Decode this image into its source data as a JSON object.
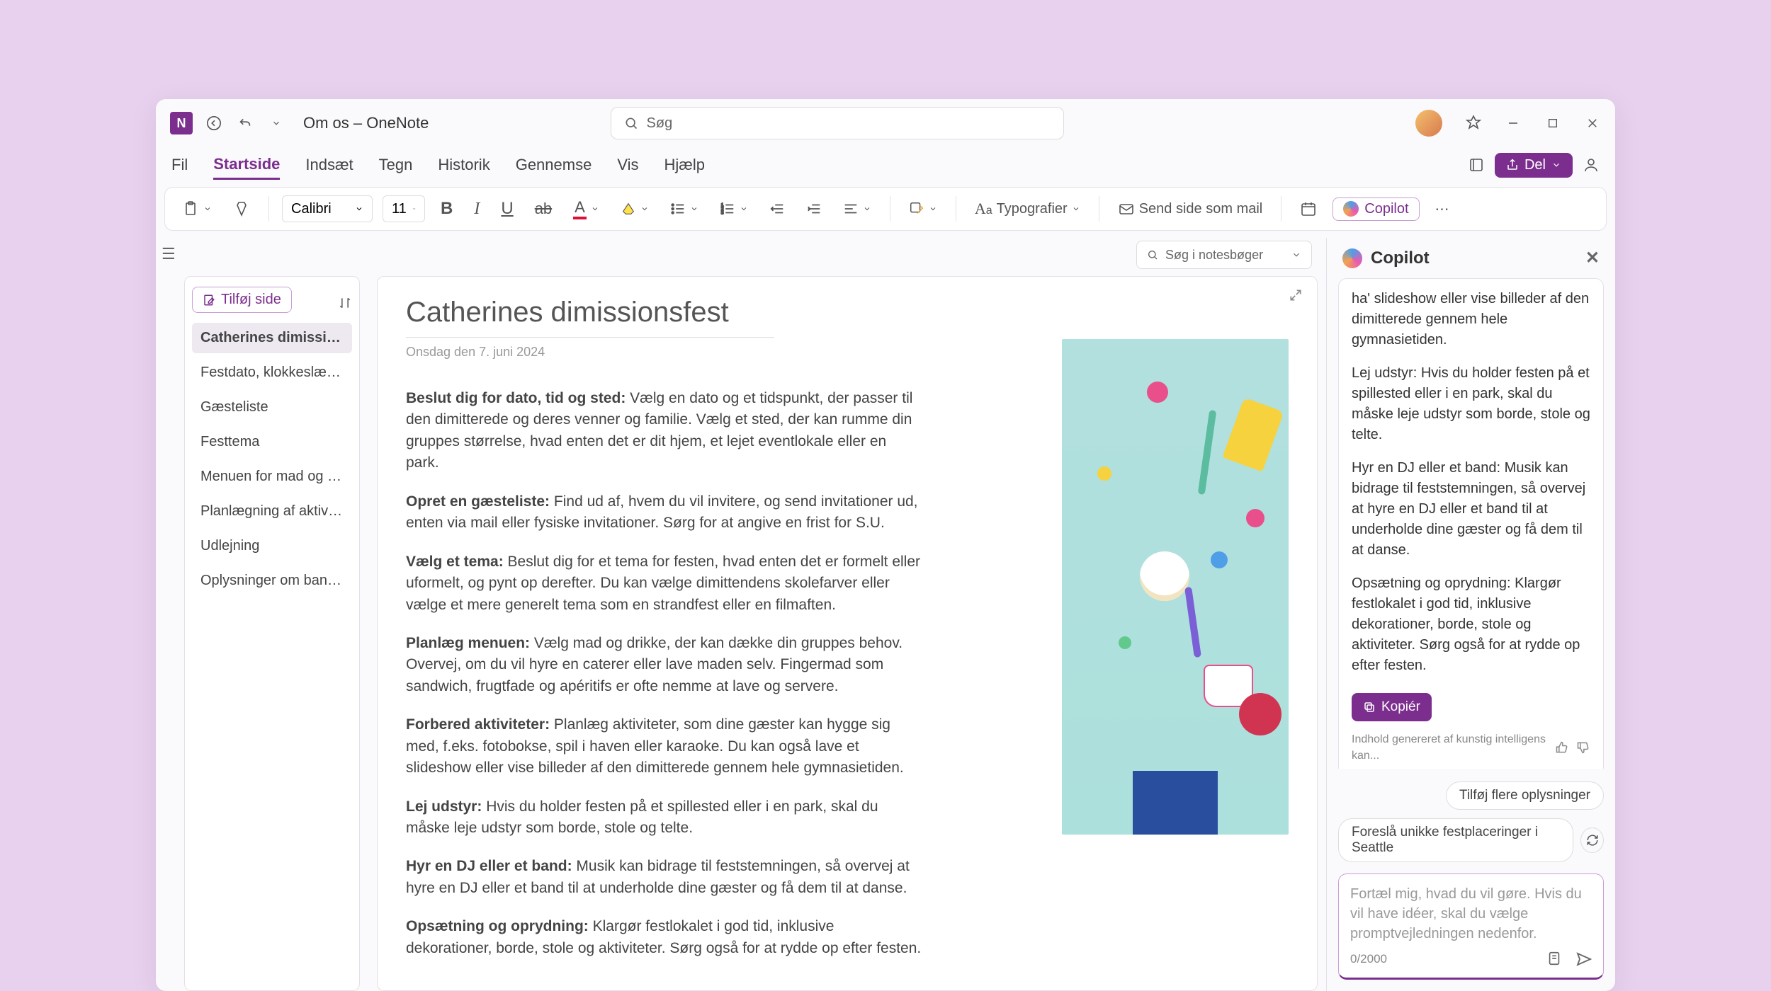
{
  "titlebar": {
    "app_title": "Om os – OneNote",
    "search_placeholder": "Søg"
  },
  "menubar": {
    "tabs": [
      "Fil",
      "Startside",
      "Indsæt",
      "Tegn",
      "Historik",
      "Gennemse",
      "Vis",
      "Hjælp"
    ],
    "active_index": 1,
    "share_label": "Del"
  },
  "ribbon": {
    "font_name": "Calibri",
    "font_size": "11",
    "styles_label": "Typografier",
    "send_label": "Send side som mail",
    "copilot_label": "Copilot"
  },
  "notebook_search_placeholder": "Søg i notesbøger",
  "sidebar": {
    "add_page_label": "Tilføj side",
    "items": [
      "Catherines dimissionsfe...",
      "Festdato, klokkeslæt og...",
      "Gæsteliste",
      "Festtema",
      "Menuen for mad og drik...",
      "Planlægning af aktiviteter",
      "Udlejning",
      "Oplysninger om bandet"
    ],
    "active_index": 0
  },
  "page": {
    "title": "Catherines dimissionsfest",
    "date": "Onsdag den 7. juni 2024",
    "paragraphs": [
      {
        "bold": "Beslut dig for dato, tid og sted:",
        "text": " Vælg en dato og et tidspunkt, der passer til den dimitterede og deres venner og familie. Vælg et sted, der kan rumme din gruppes størrelse, hvad enten det er dit hjem, et lejet eventlokale eller en park."
      },
      {
        "bold": "Opret en gæsteliste:",
        "text": " Find ud af, hvem du vil invitere, og send invitationer ud, enten via mail eller fysiske invitationer. Sørg for at angive en frist for S.U."
      },
      {
        "bold": "Vælg et tema:",
        "text": " Beslut dig for et tema for festen, hvad enten det er formelt eller uformelt, og pynt op derefter. Du kan vælge dimittendens skolefarver eller vælge et mere generelt tema som en strandfest eller en filmaften."
      },
      {
        "bold": "Planlæg menuen:",
        "text": " Vælg mad og drikke, der kan dække din gruppes behov. Overvej, om du vil hyre en caterer eller lave maden selv. Fingermad som sandwich, frugtfade og apéritifs er ofte nemme at lave og servere."
      },
      {
        "bold": "Forbered aktiviteter:",
        "text": " Planlæg aktiviteter, som dine gæster kan hygge sig med, f.eks. fotobokse, spil i haven eller karaoke. Du kan også lave et slideshow eller vise billeder af den dimitterede gennem hele gymnasietiden."
      },
      {
        "bold": "Lej udstyr:",
        "text": " Hvis du holder festen på et spillested eller i en park, skal du måske leje udstyr som borde, stole og telte."
      },
      {
        "bold": "Hyr en DJ eller et band:",
        "text": " Musik kan bidrage til feststemningen, så overvej at hyre en DJ eller et band til at underholde dine gæster og få dem til at danse."
      },
      {
        "bold": "Opsætning og oprydning:",
        "text": " Klargør festlokalet i god tid, inklusive dekorationer, borde, stole og aktiviteter. Sørg også for at rydde op efter festen."
      }
    ]
  },
  "copilot": {
    "header": "Copilot",
    "messages": [
      "ha' slideshow eller vise billeder af den dimitterede gennem hele gymnasietiden.",
      "Lej udstyr: Hvis du holder festen på et spillested eller i en park, skal du måske leje udstyr som borde, stole og telte.",
      "Hyr en DJ eller et band: Musik kan bidrage til feststemningen, så overvej at hyre en DJ eller et band til at underholde dine gæster og få dem til at danse.",
      "Opsætning og oprydning: Klargør festlokalet i god tid, inklusive dekorationer, borde, stole og aktiviteter. Sørg også for at rydde op efter festen."
    ],
    "copy_label": "Kopiér",
    "disclaimer": "Indhold genereret af kunstig intelligens kan...",
    "suggestions": [
      "Tilføj flere oplysninger",
      "Foreslå unikke festplaceringer i Seattle"
    ],
    "input_placeholder": "Fortæl mig, hvad du vil gøre. Hvis du vil have idéer, skal du vælge promptvejledningen nedenfor.",
    "counter": "0/2000"
  }
}
